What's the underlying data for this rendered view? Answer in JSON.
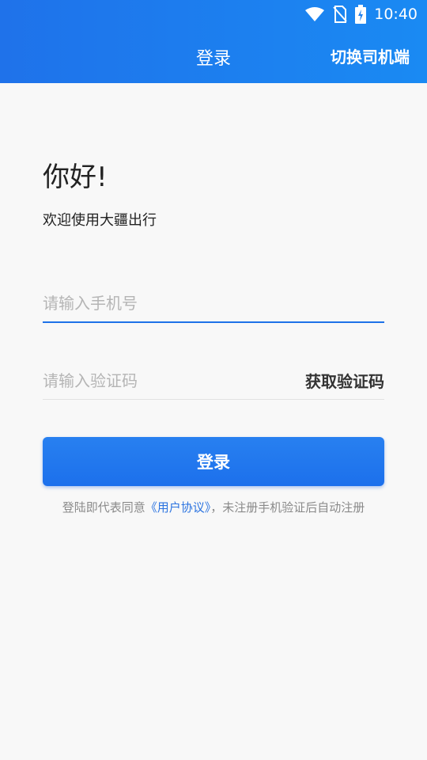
{
  "status_bar": {
    "time": "10:40",
    "icons": [
      "wifi-icon",
      "no-sim-icon",
      "battery-charging-icon"
    ]
  },
  "header": {
    "title": "登录",
    "switch_label": "切换司机端"
  },
  "greeting": {
    "title": "你好!",
    "subtitle": "欢迎使用大疆出行"
  },
  "form": {
    "phone_placeholder": "请输入手机号",
    "phone_value": "",
    "code_placeholder": "请输入验证码",
    "code_value": "",
    "get_code_label": "获取验证码",
    "login_label": "登录"
  },
  "agreement": {
    "prefix": "登陆即代表同意",
    "link": "《用户协议》",
    "suffix": "，未注册手机验证后自动注册"
  },
  "colors": {
    "primary": "#1f72ea",
    "background": "#f8f8f8",
    "link": "#2b73e0"
  }
}
